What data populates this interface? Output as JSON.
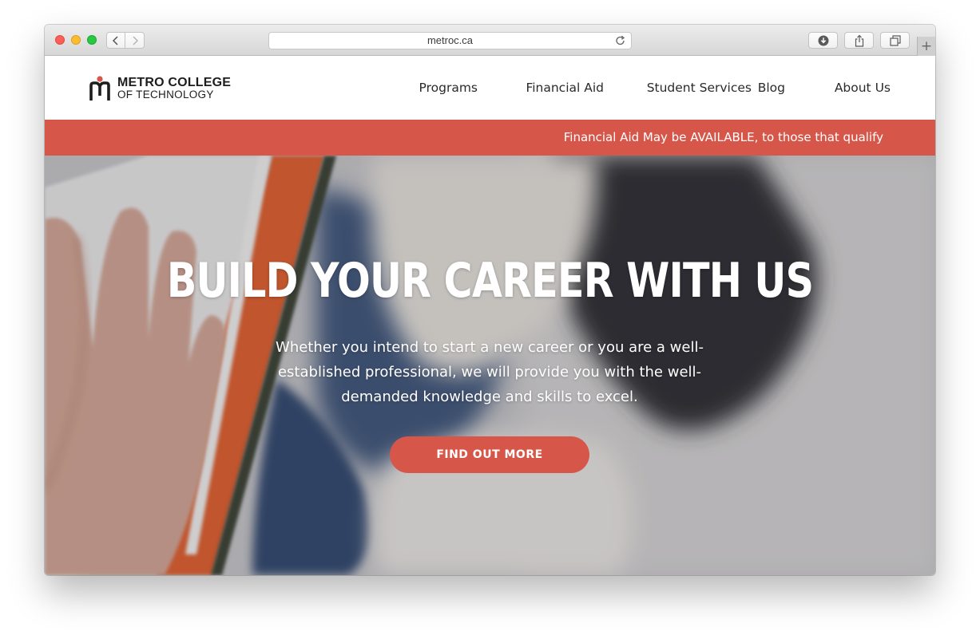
{
  "browser": {
    "url": "metroc.ca",
    "icons": {
      "back": "chevron-left-icon",
      "forward": "chevron-right-icon",
      "reload": "reload-icon",
      "download": "download-icon",
      "share": "share-icon",
      "tabs": "tabs-icon",
      "new_tab": "plus-icon"
    },
    "new_tab_label": "+"
  },
  "site": {
    "logo": {
      "line1": "METRO COLLEGE",
      "line2": "OF TECHNOLOGY"
    },
    "nav": [
      {
        "label": "Programs"
      },
      {
        "label": "Financial Aid"
      },
      {
        "label": "Student Services"
      },
      {
        "label": "Blog"
      },
      {
        "label": "About Us"
      }
    ],
    "announcement": "Financial Aid May be AVAILABLE, to those that qualify",
    "hero": {
      "title": "BUILD YOUR CAREER WITH US",
      "subtitle": "Whether you intend to start a new career or you are a well-established professional, we will provide you with the well-demanded knowledge and skills to excel.",
      "cta": "FIND OUT MORE"
    },
    "colors": {
      "accent": "#d6574a",
      "text": "#2a2a2a",
      "white": "#ffffff"
    }
  }
}
